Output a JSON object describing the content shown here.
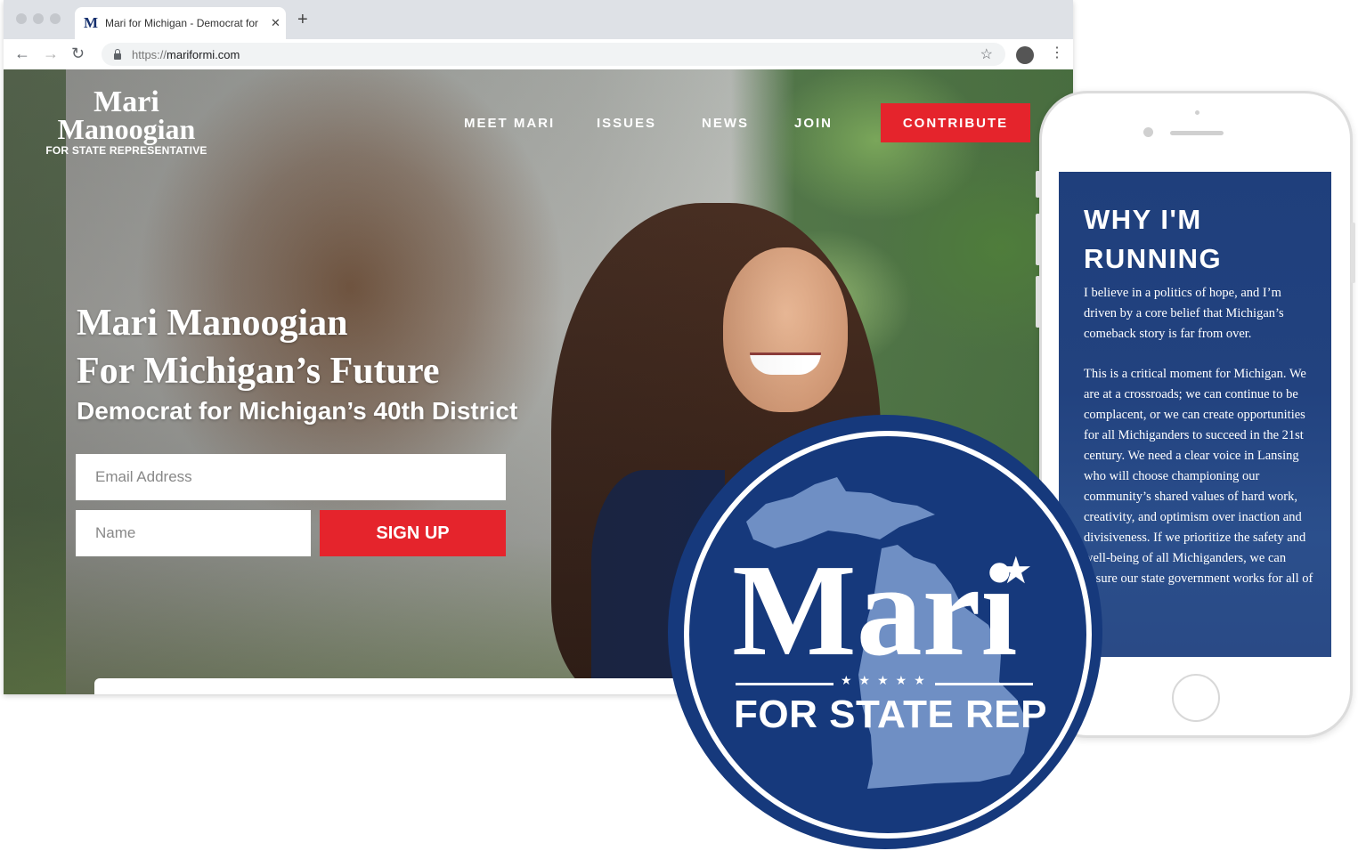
{
  "browser": {
    "tab": {
      "favicon": "M",
      "title": "Mari for Michigan - Democrat for",
      "close_icon": "✕"
    },
    "new_tab_icon": "+",
    "nav": {
      "back_icon": "←",
      "forward_icon": "→",
      "reload_icon": "↻"
    },
    "url_protocol": "https://",
    "url_host": "mariformi.com",
    "bookmark_icon": "☆",
    "menu_icon": "⋮"
  },
  "site": {
    "logo": {
      "first": "Mari",
      "last": "Manoogian",
      "subtitle": "FOR STATE REPRESENTATIVE"
    },
    "nav": [
      "MEET MARI",
      "ISSUES",
      "NEWS",
      "JOIN"
    ],
    "contribute_label": "CONTRIBUTE",
    "hero": {
      "title_line1": "Mari Manoogian",
      "title_line2": "For Michigan’s Future",
      "subtitle": "Democrat for Michigan’s 40th District"
    },
    "form": {
      "email_placeholder": "Email Address",
      "name_placeholder": "Name",
      "signup_label": "SIGN UP"
    }
  },
  "phone": {
    "heading": "WHY I'M RUNNING",
    "paragraph1": "I believe in a politics of hope, and I’m driven by a core belief that Michigan’s comeback story is far from over.",
    "paragraph2": "This is a critical moment for Michigan. We are at a crossroads; we can continue to be complacent, or we can create opportunities for all Michiganders to succeed in the 21st century. We need a clear voice in Lansing who will choose championing our community’s shared values of hard work, creativity, and optimism over inaction and divisiveness. If we prioritize the safety and well-being of all Michiganders, we can ensure our state government works for all of us."
  },
  "badge": {
    "name": "Mari",
    "stars": "★★★★★",
    "tagline": "FOR STATE REP",
    "colors": {
      "navy": "#16397c",
      "michigan": "#6f8fc4"
    }
  },
  "colors": {
    "accent_red": "#e5242c"
  }
}
